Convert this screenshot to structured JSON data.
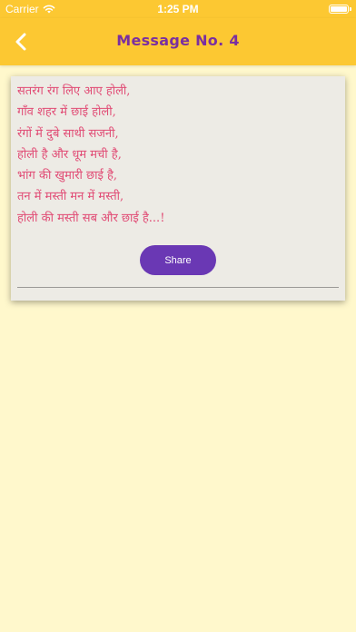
{
  "status_bar": {
    "carrier": "Carrier",
    "time": "1:25 PM",
    "wifi_icon": "wifi-icon",
    "battery_icon": "battery-icon",
    "battery_level": 1.0
  },
  "nav": {
    "back_icon": "chevron-left-icon",
    "title": "Message No. 4"
  },
  "message": {
    "text": "सतरंग रंग लिए आए होली,\nगाँव शहर में छाई होली,\nरंगों में दुबे साथी सजनी,\nहोली है और धूम मची है,\nभांग की खुमारी छाई है,\nतन में मस्ती मन में मस्ती,\nहोली की मस्ती सब और छाई है...!",
    "share_label": "Share"
  },
  "colors": {
    "header": "#fcc832",
    "background": "#fff8cc",
    "title": "#7a2fa0",
    "message_text": "#e14d76",
    "share_button": "#6a38b4",
    "card": "#edebe5"
  }
}
